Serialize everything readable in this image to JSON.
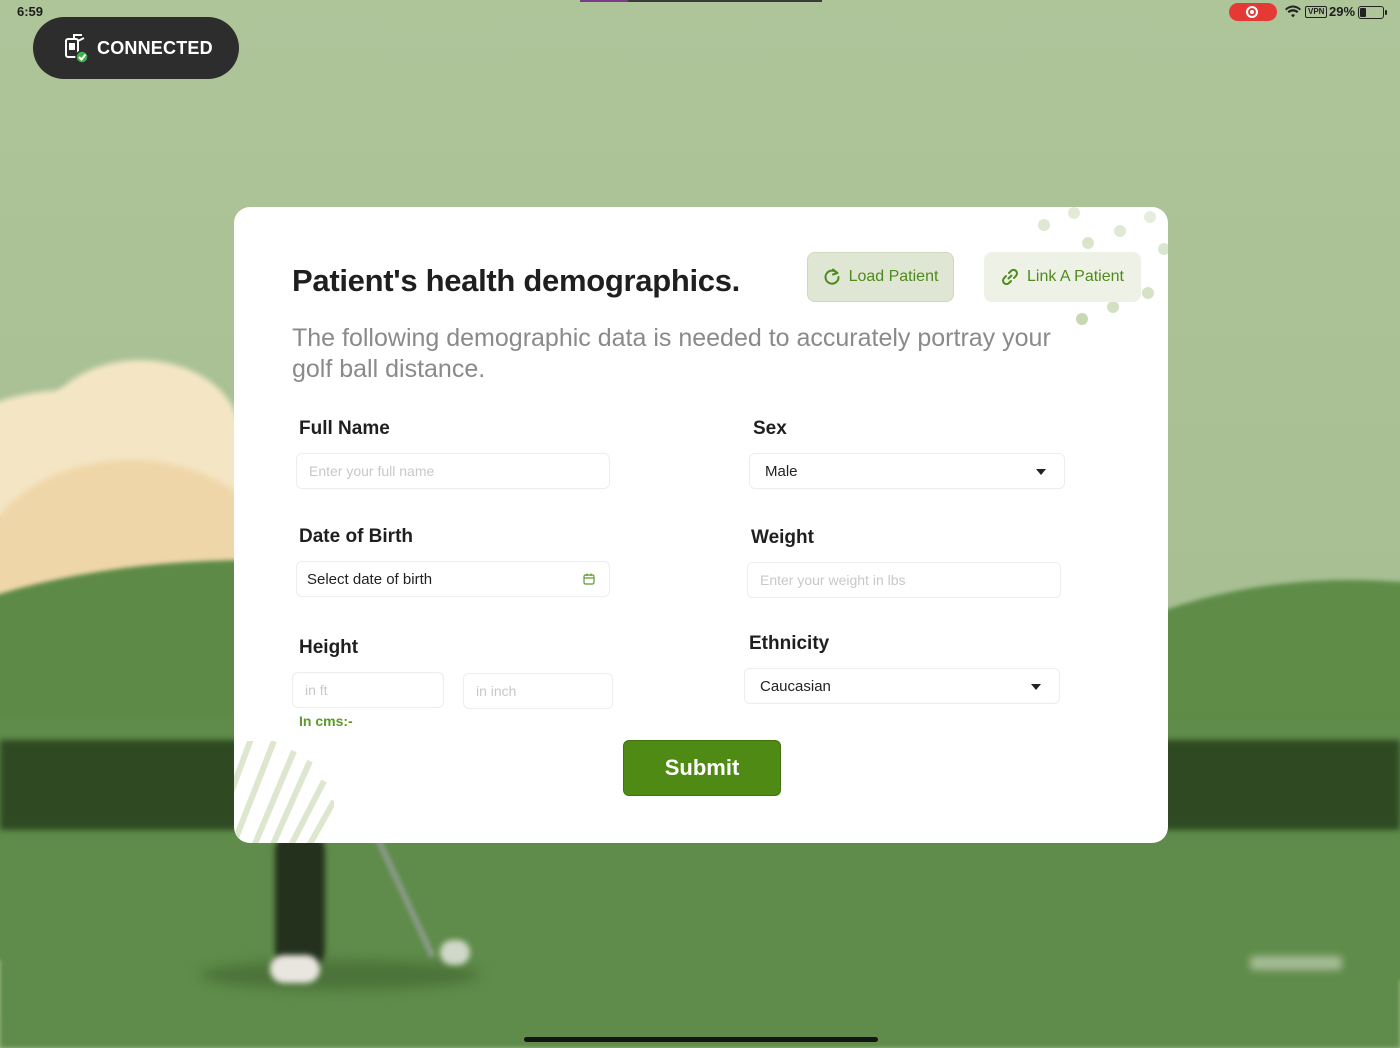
{
  "status_bar": {
    "time": "6:59",
    "vpn_label": "VPN",
    "battery_percent": "29%",
    "recording_color": "#e53935"
  },
  "connection": {
    "label": "CONNECTED",
    "icon": "device-check-icon",
    "accent": "#3fb04a"
  },
  "form": {
    "title": "Patient's health demographics.",
    "subtitle": "The following demographic data is needed to accurately portray your golf ball distance.",
    "load_patient_label": "Load Patient",
    "link_patient_label": "Link A Patient",
    "full_name": {
      "label": "Full Name",
      "placeholder": "Enter your full name",
      "value": ""
    },
    "sex": {
      "label": "Sex",
      "selected": "Male"
    },
    "date_of_birth": {
      "label": "Date of Birth",
      "placeholder": "Select date of birth"
    },
    "weight": {
      "label": "Weight",
      "placeholder": "Enter your weight in lbs",
      "value": ""
    },
    "height": {
      "label": "Height",
      "ft_placeholder": "in ft",
      "inch_placeholder": "in inch",
      "cms_label": "In cms:-"
    },
    "ethnicity": {
      "label": "Ethnicity",
      "selected": "Caucasian"
    },
    "submit_label": "Submit"
  },
  "colors": {
    "brand_green": "#4f8a14",
    "accent_green_text": "#4f8a1c",
    "card_background": "#ffffff"
  }
}
